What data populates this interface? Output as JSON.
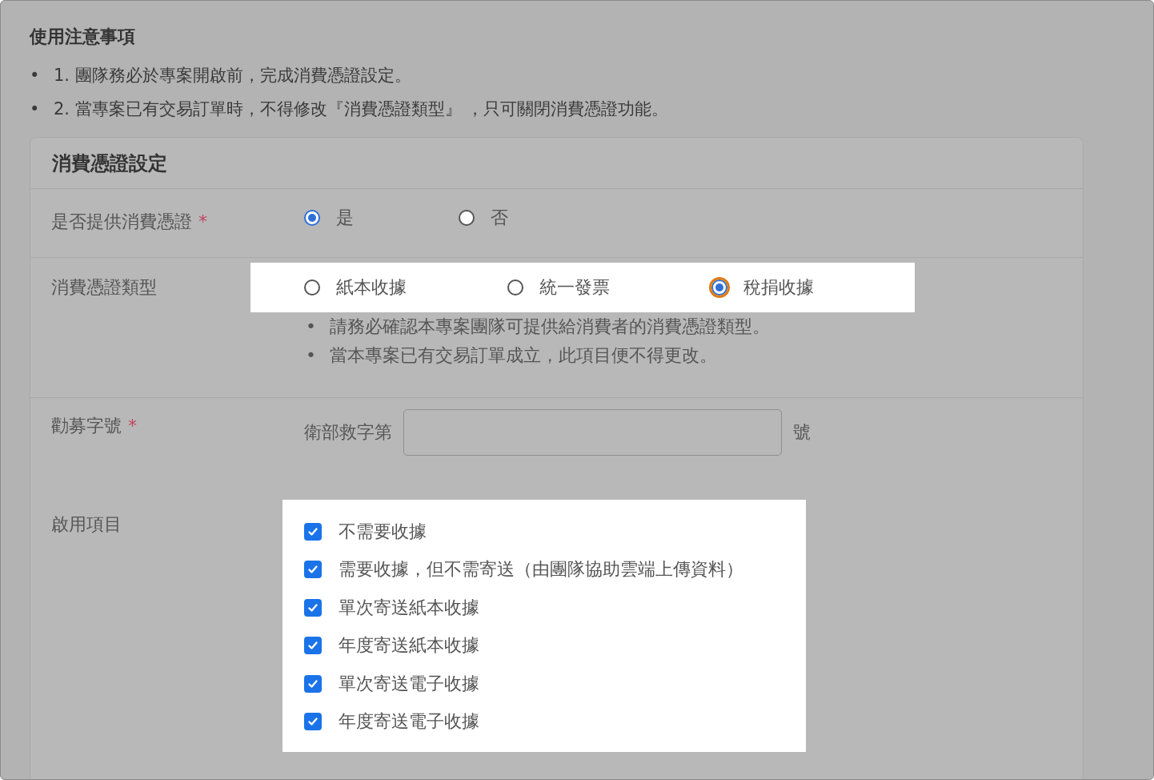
{
  "notice": {
    "title": "使用注意事項",
    "bullet": "•",
    "items": [
      "1. 團隊務必於專案開啟前，完成消費憑證設定。",
      "2. 當專案已有交易訂單時，不得修改『消費憑證類型』 ，只可關閉消費憑證功能。"
    ]
  },
  "form": {
    "title": "消費憑證設定",
    "provide": {
      "label": "是否提供消費憑證",
      "required_mark": "*",
      "options": [
        {
          "label": "是",
          "selected": true,
          "focused": false
        },
        {
          "label": "否",
          "selected": false,
          "focused": false
        }
      ]
    },
    "type": {
      "label": "消費憑證類型",
      "highlighted": true,
      "options": [
        {
          "label": "紙本收據",
          "selected": false,
          "focused": false
        },
        {
          "label": "統一發票",
          "selected": false,
          "focused": false
        },
        {
          "label": "稅捐收據",
          "selected": true,
          "focused": true
        }
      ],
      "note_bullet": "•",
      "notes": [
        "請務必確認本專案團隊可提供給消費者的消費憑證類型。",
        "當本專案已有交易訂單成立，此項目便不得更改。"
      ]
    },
    "permit": {
      "label": "勸募字號",
      "required_mark": "*",
      "prefix": "衛部救字第",
      "suffix": "號"
    },
    "enabled": {
      "label": "啟用項目",
      "highlighted": true,
      "items": [
        {
          "label": "不需要收據",
          "checked": true
        },
        {
          "label": "需要收據，但不需寄送（由團隊協助雲端上傳資料）",
          "checked": true
        },
        {
          "label": "單次寄送紙本收據",
          "checked": true
        },
        {
          "label": "年度寄送紙本收據",
          "checked": true
        },
        {
          "label": "單次寄送電子收據",
          "checked": true
        },
        {
          "label": "年度寄送電子收據",
          "checked": true
        }
      ]
    }
  }
}
